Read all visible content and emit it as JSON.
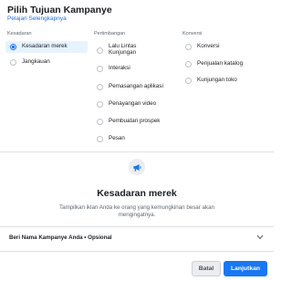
{
  "dialog": {
    "title": "Pilih Tujuan Kampanye",
    "learn_more": "Pelajari Selengkapnya"
  },
  "columns": [
    {
      "heading": "Kesadaran",
      "options": [
        {
          "label": "Kesadaran merek",
          "selected": true
        },
        {
          "label": "Jangkauan",
          "selected": false
        }
      ]
    },
    {
      "heading": "Pertimbangan",
      "options": [
        {
          "label": "Lalu Lintas Kunjungan",
          "selected": false
        },
        {
          "label": "Interaksi",
          "selected": false
        },
        {
          "label": "Pemasangan aplikasi",
          "selected": false
        },
        {
          "label": "Penayangan video",
          "selected": false
        },
        {
          "label": "Pembuatan prospek",
          "selected": false
        },
        {
          "label": "Pesan",
          "selected": false
        }
      ]
    },
    {
      "heading": "Konversi",
      "options": [
        {
          "label": "Konversi",
          "selected": false
        },
        {
          "label": "Penjualan katalog",
          "selected": false
        },
        {
          "label": "Kunjungan toko",
          "selected": false
        }
      ]
    }
  ],
  "objective": {
    "icon": "megaphone-icon",
    "title": "Kesadaran merek",
    "description": "Tampilkan iklan Anda ke orang yang kemungkinan besar akan mengingatnya."
  },
  "campaign_name": {
    "label": "Beri Nama Kampanye Anda • Opsional"
  },
  "footer": {
    "cancel": "Batal",
    "continue": "Lanjutkan"
  },
  "colors": {
    "accent": "#1877f2",
    "selected_bg": "#e7f3ff",
    "link": "#216fdb"
  }
}
